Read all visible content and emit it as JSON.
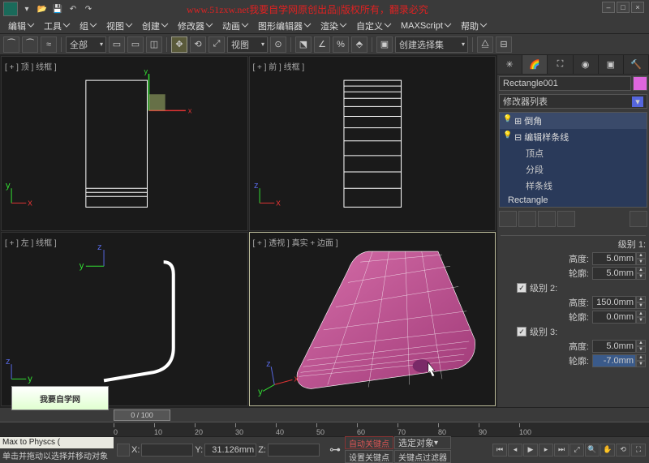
{
  "watermark": "www.51zxw.net我要自学网原创出品||版权所有，翻录必究",
  "menu": [
    "编辑",
    "工具",
    "组",
    "视图",
    "创建",
    "修改器",
    "动画",
    "图形编辑器",
    "渲染",
    "自定义",
    "MAXScript",
    "帮助"
  ],
  "toolbar": {
    "filter": "全部",
    "view": "视图",
    "selset": "创建选择集"
  },
  "viewports": {
    "top": "[ + ] 顶 ] 线框 ]",
    "front": "[ + ] 前 ] 线框 ]",
    "left": "[ + ] 左 ] 线框 ]",
    "persp": "[ + ] 透视 ] 真实 + 边面 ]"
  },
  "object_name": "Rectangle001",
  "modifier_dropdown": "修改器列表",
  "mod_stack": {
    "bevel": "倒角",
    "editspline": "编辑样条线",
    "vertex": "顶点",
    "segment": "分段",
    "spline": "样条线",
    "rectangle": "Rectangle"
  },
  "params": {
    "level1_label": "级别 1:",
    "level2_label": "级别 2:",
    "level3_label": "级别 3:",
    "height_label": "高度:",
    "outline_label": "轮廓:",
    "l1_height": "5.0mm",
    "l1_outline": "5.0mm",
    "l2_height": "150.0mm",
    "l2_outline": "0.0mm",
    "l3_height": "5.0mm",
    "l3_outline": "-7.0mm"
  },
  "timeline": {
    "current": "0 / 100",
    "ticks": [
      "0",
      "10",
      "20",
      "30",
      "40",
      "50",
      "60",
      "70",
      "80",
      "90",
      "100"
    ]
  },
  "status": {
    "script": "Max to Physcs (",
    "hint": "单击并拖动以选择并移动对象",
    "x": "",
    "y": "31.126mm",
    "z": "",
    "autokey": "自动关键点",
    "selobj": "选定对象",
    "setkey": "设置关键点",
    "keyfilter": "关键点过滤器"
  },
  "brand": "我要自学网"
}
